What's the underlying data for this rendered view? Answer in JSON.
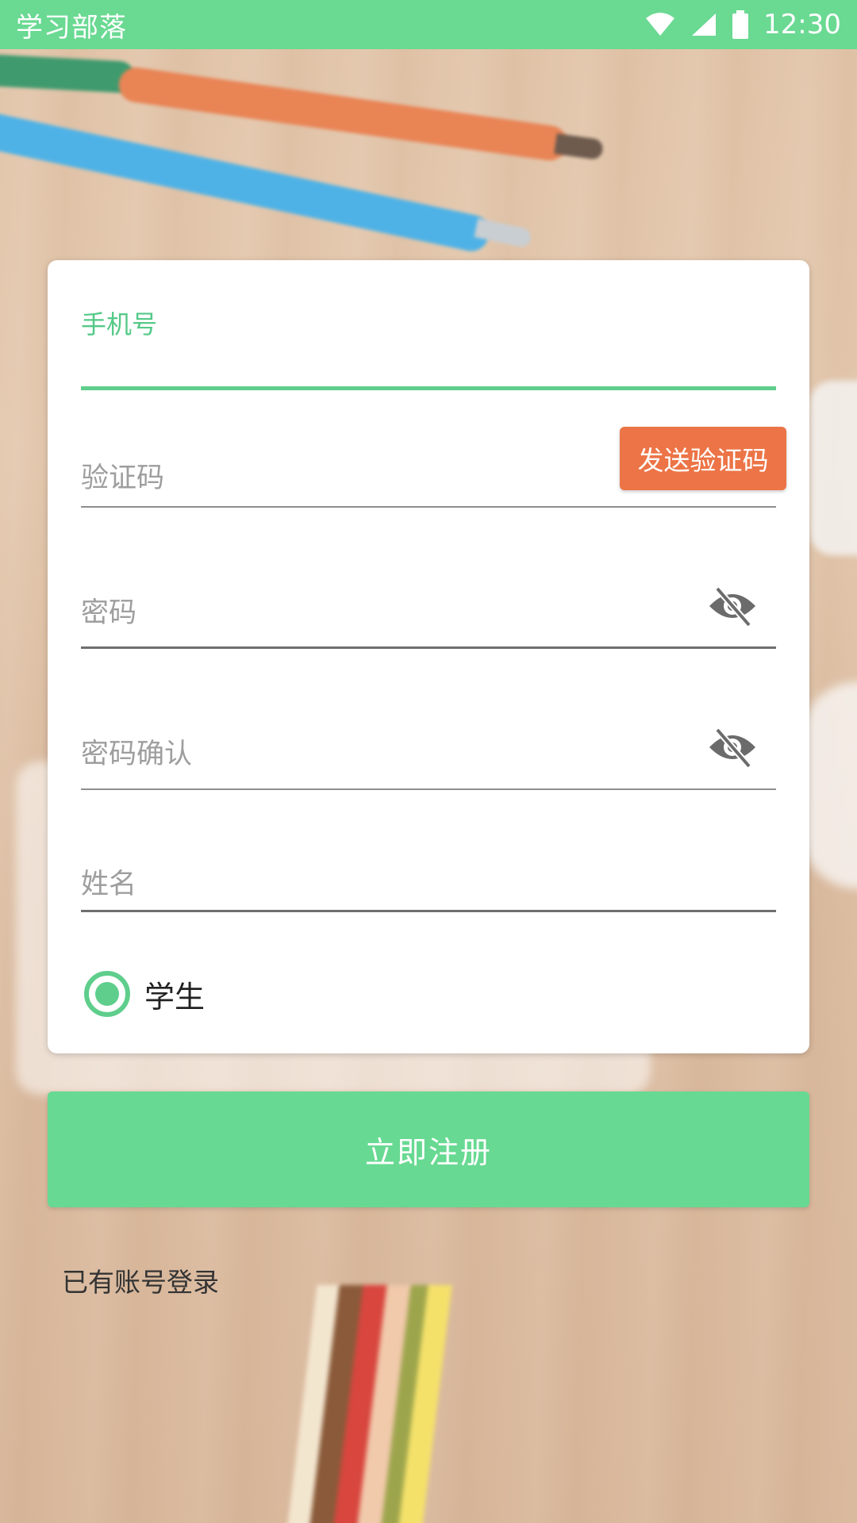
{
  "status_bar": {
    "app_title": "学习部落",
    "time": "12:30"
  },
  "form": {
    "phone_label": "手机号",
    "code_placeholder": "验证码",
    "send_code_label": "发送验证码",
    "password_placeholder": "密码",
    "password_confirm_placeholder": "密码确认",
    "name_placeholder": "姓名",
    "role_option": "学生",
    "role_selected": true
  },
  "actions": {
    "register_label": "立即注册",
    "login_link": "已有账号登录"
  },
  "colors": {
    "accent": "#68d992",
    "send_code": "#ec7446"
  },
  "icons": {
    "wifi": "wifi-icon",
    "signal": "signal-icon",
    "battery": "battery-icon",
    "eye_off": "eye-off-icon"
  }
}
